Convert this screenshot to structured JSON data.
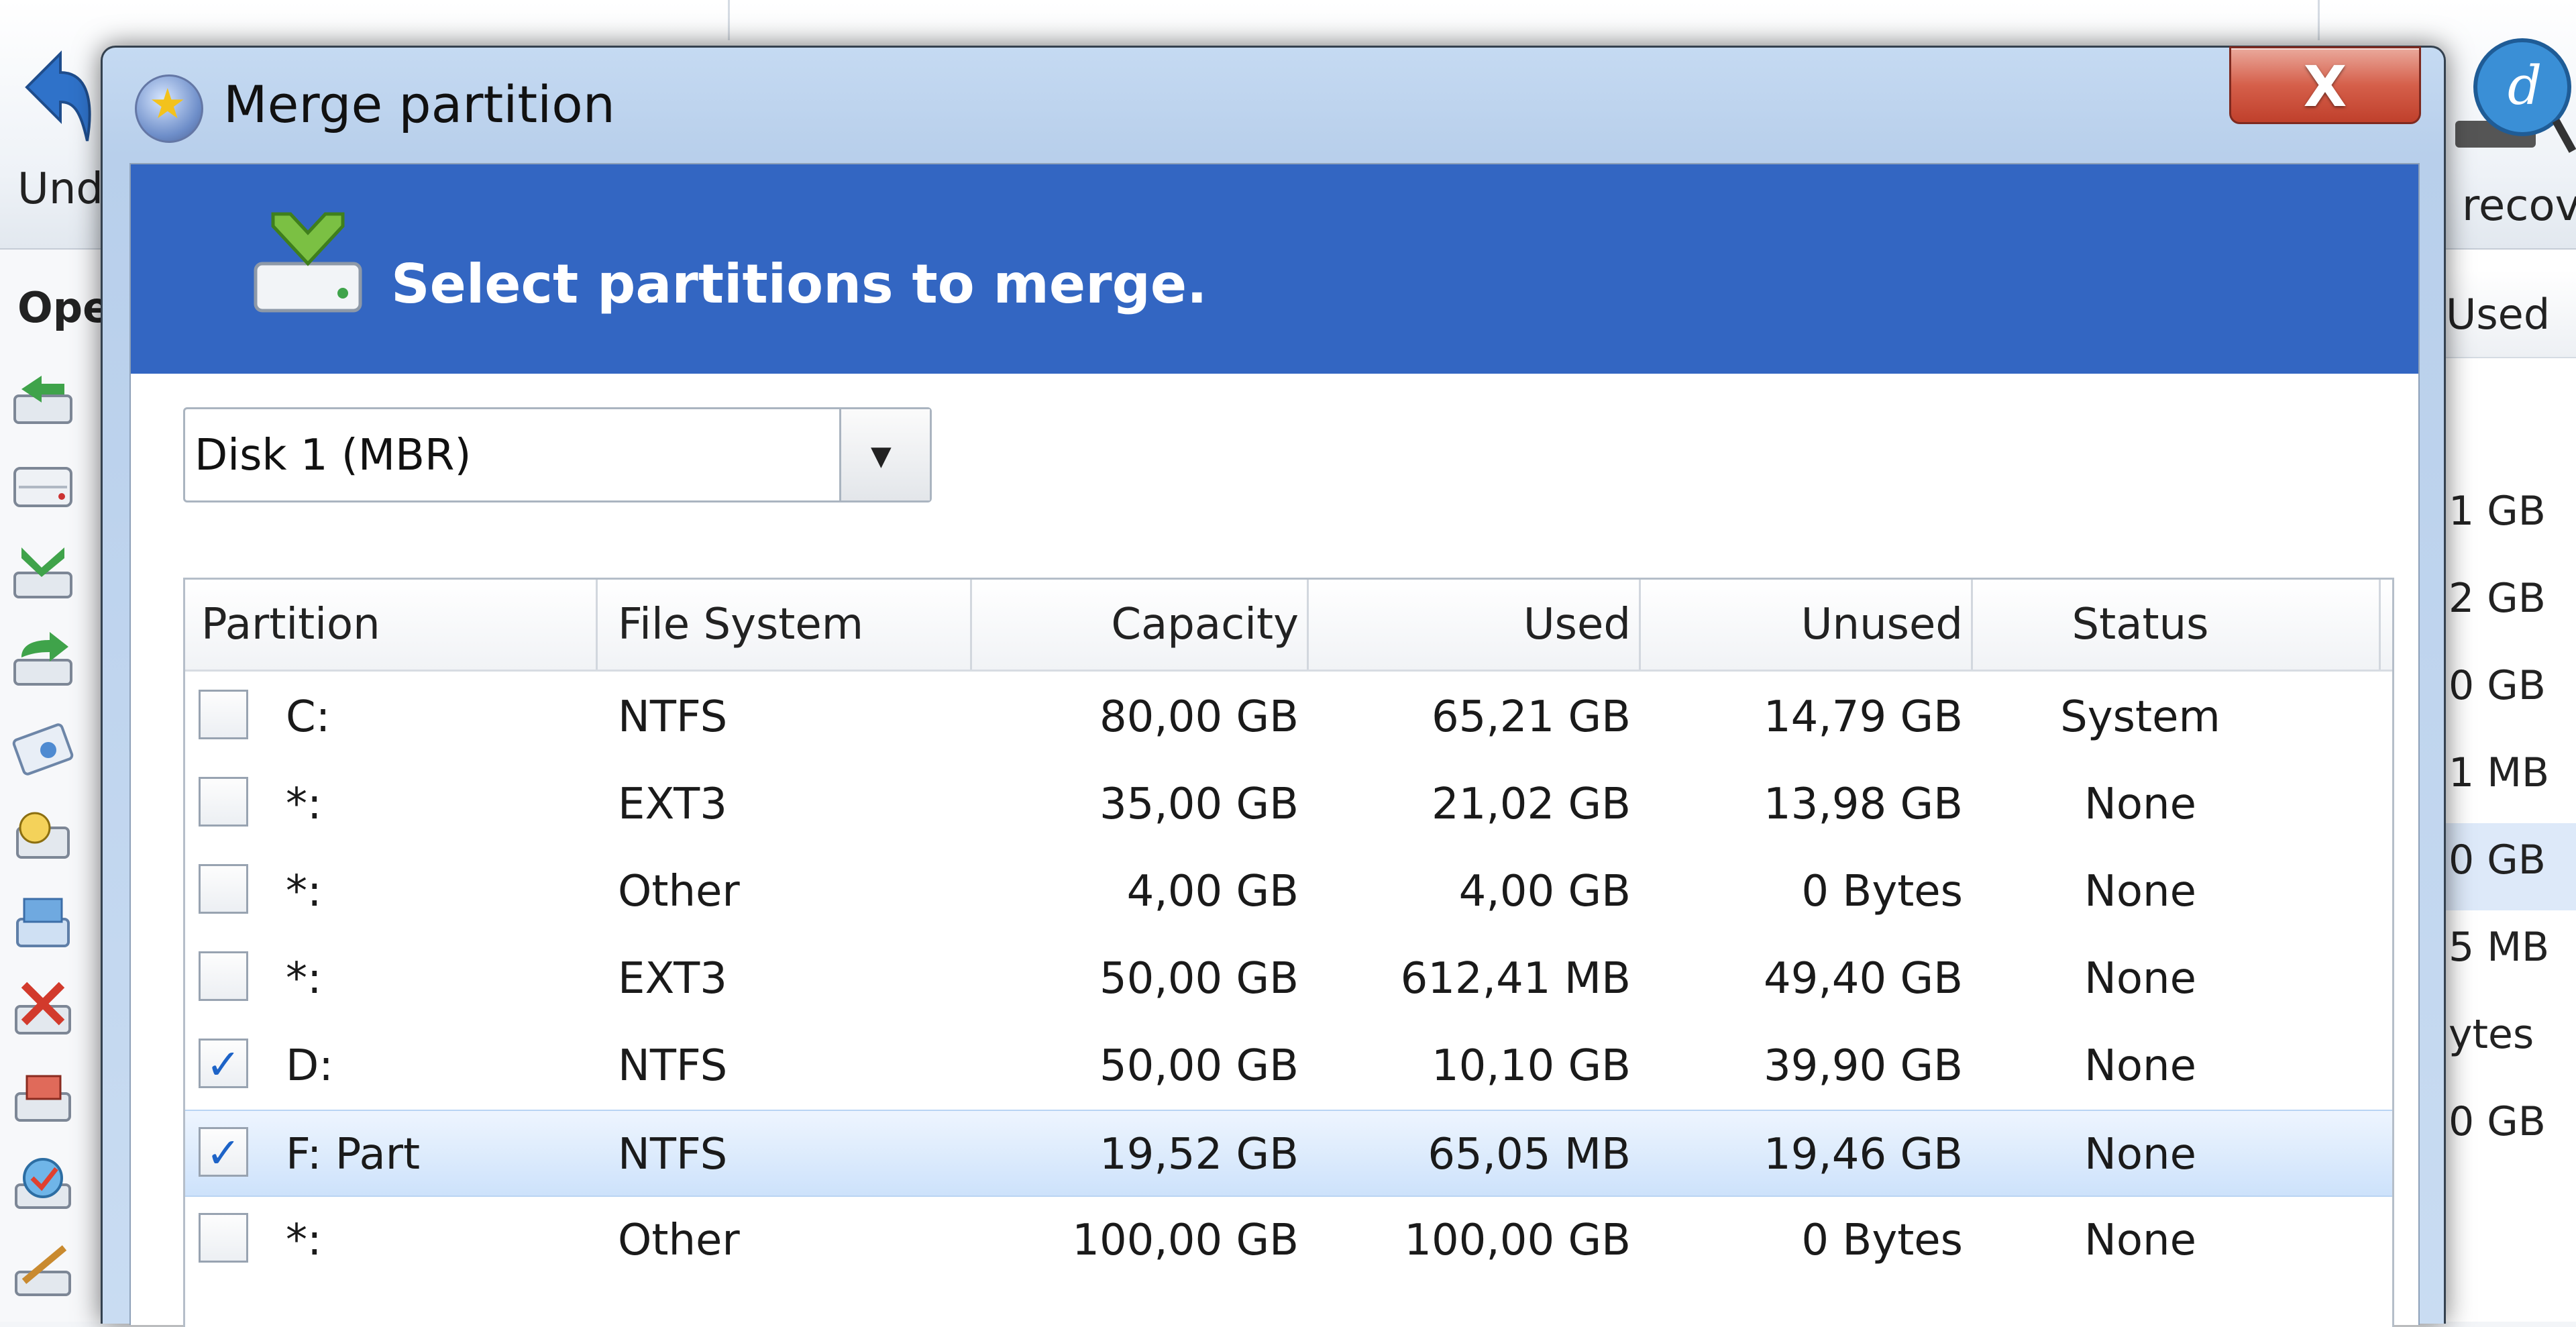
{
  "app": {
    "toolbar": {
      "undo_label": "Und",
      "recover_label": "recov"
    },
    "left_panel": {
      "title": "Ope"
    },
    "right_grid": {
      "header": "Used",
      "cells": [
        "1 GB",
        "2 GB",
        "0 GB",
        "1 MB",
        "0 GB",
        "5 MB",
        "ytes",
        "0 GB"
      ]
    }
  },
  "dialog": {
    "title": "Merge partition",
    "close_label": "X",
    "banner_text": "Select partitions to merge.",
    "disk_select": {
      "value": "Disk 1 (MBR)"
    },
    "table": {
      "columns": [
        "Partition",
        "File System",
        "Capacity",
        "Used",
        "Unused",
        "Status"
      ],
      "rows": [
        {
          "checked": false,
          "partition": "C:",
          "fs": "NTFS",
          "capacity": "80,00 GB",
          "used": "65,21 GB",
          "unused": "14,79 GB",
          "status": "System"
        },
        {
          "checked": false,
          "partition": "*:",
          "fs": "EXT3",
          "capacity": "35,00 GB",
          "used": "21,02 GB",
          "unused": "13,98 GB",
          "status": "None"
        },
        {
          "checked": false,
          "partition": "*:",
          "fs": "Other",
          "capacity": "4,00 GB",
          "used": "4,00 GB",
          "unused": "0 Bytes",
          "status": "None"
        },
        {
          "checked": false,
          "partition": "*:",
          "fs": "EXT3",
          "capacity": "50,00 GB",
          "used": "612,41 MB",
          "unused": "49,40 GB",
          "status": "None"
        },
        {
          "checked": true,
          "partition": "D:",
          "fs": "NTFS",
          "capacity": "50,00 GB",
          "used": "10,10 GB",
          "unused": "39,90 GB",
          "status": "None"
        },
        {
          "checked": true,
          "selected": true,
          "partition": "F: Part",
          "fs": "NTFS",
          "capacity": "19,52 GB",
          "used": "65,05 MB",
          "unused": "19,46 GB",
          "status": "None"
        },
        {
          "checked": false,
          "partition": "*:",
          "fs": "Other",
          "capacity": "100,00 GB",
          "used": "100,00 GB",
          "unused": "0 Bytes",
          "status": "None"
        }
      ]
    }
  },
  "colors": {
    "banner": "#3366c2",
    "selected_row": "#cde2fb",
    "close_button": "#d55f4a",
    "check_mark": "#1d63c7"
  },
  "icons": [
    "undo-icon",
    "data-recovery-icon",
    "merge-partition-icon",
    "dropdown-arrow-icon",
    "check-icon",
    "close-icon"
  ]
}
